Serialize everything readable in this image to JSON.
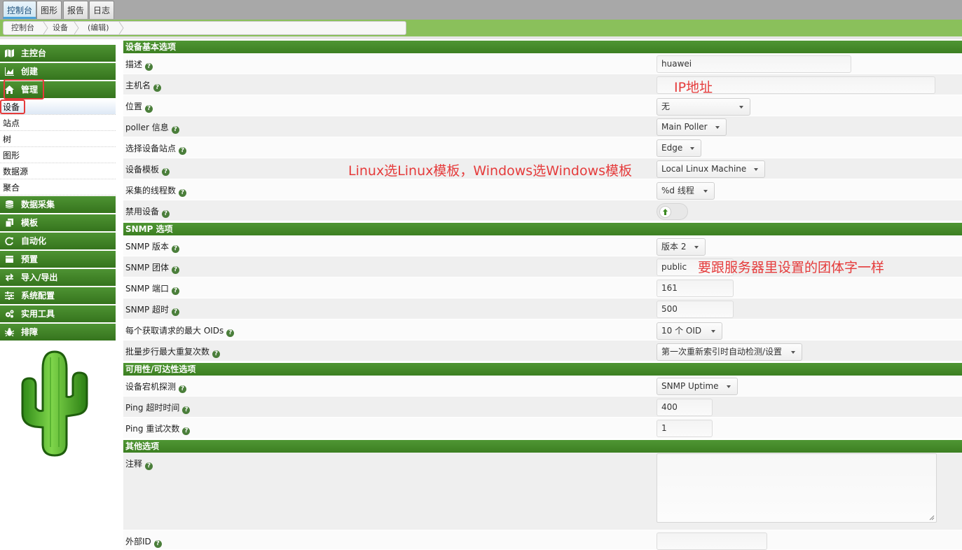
{
  "top_tabs": [
    {
      "label": "控制台",
      "active": true
    },
    {
      "label": "图形",
      "active": false
    },
    {
      "label": "报告",
      "active": false
    },
    {
      "label": "日志",
      "active": false
    }
  ],
  "breadcrumb": [
    "控制台",
    "设备",
    "(编辑)"
  ],
  "sidebar": {
    "headers_top": [
      {
        "label": "主控台",
        "icon": "map-icon"
      },
      {
        "label": "创建",
        "icon": "chart-icon"
      },
      {
        "label": "管理",
        "icon": "home-icon"
      }
    ],
    "subitems": [
      {
        "label": "设备",
        "selected": true
      },
      {
        "label": "站点",
        "selected": false
      },
      {
        "label": "树",
        "selected": false
      },
      {
        "label": "图形",
        "selected": false
      },
      {
        "label": "数据源",
        "selected": false
      },
      {
        "label": "聚合",
        "selected": false
      }
    ],
    "headers_bottom": [
      {
        "label": "数据采集",
        "icon": "database-icon"
      },
      {
        "label": "模板",
        "icon": "copy-icon"
      },
      {
        "label": "自动化",
        "icon": "refresh-icon"
      },
      {
        "label": "预置",
        "icon": "list-icon"
      },
      {
        "label": "导入/导出",
        "icon": "exchange-icon"
      },
      {
        "label": "系统配置",
        "icon": "sliders-icon"
      },
      {
        "label": "实用工具",
        "icon": "cogs-icon"
      },
      {
        "label": "排障",
        "icon": "bug-icon"
      }
    ]
  },
  "sections": {
    "basic": "设备基本选项",
    "snmp": "SNMP 选项",
    "availability": "可用性/可达性选项",
    "other": "其他选项"
  },
  "fields": {
    "description": {
      "label": "描述",
      "value": "huawei"
    },
    "hostname": {
      "label": "主机名",
      "value": ""
    },
    "location": {
      "label": "位置",
      "value": "无"
    },
    "poller": {
      "label": "poller 信息",
      "value": "Main Poller"
    },
    "site": {
      "label": "选择设备站点",
      "value": "Edge"
    },
    "template": {
      "label": "设备模板",
      "value": "Local Linux Machine"
    },
    "threads": {
      "label": "采集的线程数",
      "value": "%d 线程"
    },
    "disable": {
      "label": "禁用设备",
      "value": false
    },
    "snmp_version": {
      "label": "SNMP 版本",
      "value": "版本 2"
    },
    "snmp_community": {
      "label": "SNMP 团体",
      "value": "public"
    },
    "snmp_port": {
      "label": "SNMP 端口",
      "value": "161"
    },
    "snmp_timeout": {
      "label": "SNMP 超时",
      "value": "500"
    },
    "max_oids": {
      "label": "每个获取请求的最大 OIDs",
      "value": "10 个 OID"
    },
    "bulk_walk": {
      "label": "批量步行最大重复次数",
      "value": "第一次重新索引时自动检测/设置"
    },
    "down_detect": {
      "label": "设备宕机探测",
      "value": "SNMP Uptime"
    },
    "ping_timeout": {
      "label": "Ping 超时时间",
      "value": "400"
    },
    "ping_retries": {
      "label": "Ping 重试次数",
      "value": "1"
    },
    "notes": {
      "label": "注释",
      "value": ""
    },
    "external_id": {
      "label": "外部ID",
      "value": ""
    }
  },
  "help_glyph": "?",
  "annotations": {
    "hostname": "IP地址",
    "template": "Linux选Linux模板，Windows选Windows模板",
    "community": "要跟服务器里设置的团体字一样"
  },
  "colors": {
    "nav_green": "#3c7f22",
    "band_green": "#8ac05b",
    "annotation_red": "#e53b3b",
    "help_green": "#4a7e3a"
  }
}
